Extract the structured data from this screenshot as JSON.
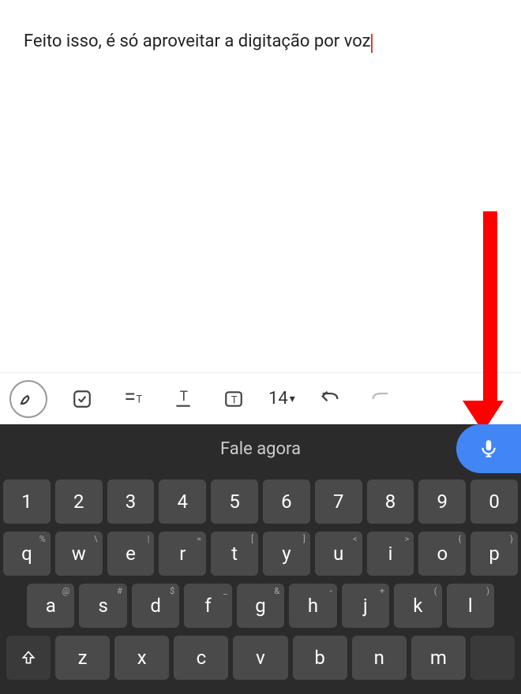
{
  "editor": {
    "text": "Feito isso, é só aproveitar a digitação por voz"
  },
  "toolbar": {
    "font_size": "14"
  },
  "voice": {
    "prompt": "Fale agora"
  },
  "keyboard": {
    "row1": [
      {
        "main": "1",
        "sup": ""
      },
      {
        "main": "2",
        "sup": ""
      },
      {
        "main": "3",
        "sup": ""
      },
      {
        "main": "4",
        "sup": ""
      },
      {
        "main": "5",
        "sup": ""
      },
      {
        "main": "6",
        "sup": ""
      },
      {
        "main": "7",
        "sup": ""
      },
      {
        "main": "8",
        "sup": ""
      },
      {
        "main": "9",
        "sup": ""
      },
      {
        "main": "0",
        "sup": ""
      }
    ],
    "row2": [
      {
        "main": "q",
        "sup": "%"
      },
      {
        "main": "w",
        "sup": "\\"
      },
      {
        "main": "e",
        "sup": "|"
      },
      {
        "main": "r",
        "sup": "="
      },
      {
        "main": "t",
        "sup": "["
      },
      {
        "main": "y",
        "sup": "]"
      },
      {
        "main": "u",
        "sup": "<"
      },
      {
        "main": "i",
        "sup": ">"
      },
      {
        "main": "o",
        "sup": "{"
      },
      {
        "main": "p",
        "sup": "}"
      }
    ],
    "row3": [
      {
        "main": "a",
        "sup": "@"
      },
      {
        "main": "s",
        "sup": "#"
      },
      {
        "main": "d",
        "sup": "$"
      },
      {
        "main": "f",
        "sup": "_"
      },
      {
        "main": "g",
        "sup": "&"
      },
      {
        "main": "h",
        "sup": "-"
      },
      {
        "main": "j",
        "sup": "+"
      },
      {
        "main": "k",
        "sup": "("
      },
      {
        "main": "l",
        "sup": ")"
      }
    ],
    "row4": [
      {
        "main": "z",
        "sup": ""
      },
      {
        "main": "x",
        "sup": ""
      },
      {
        "main": "c",
        "sup": ""
      },
      {
        "main": "v",
        "sup": ""
      },
      {
        "main": "b",
        "sup": ""
      },
      {
        "main": "n",
        "sup": ""
      },
      {
        "main": "m",
        "sup": ""
      }
    ]
  }
}
